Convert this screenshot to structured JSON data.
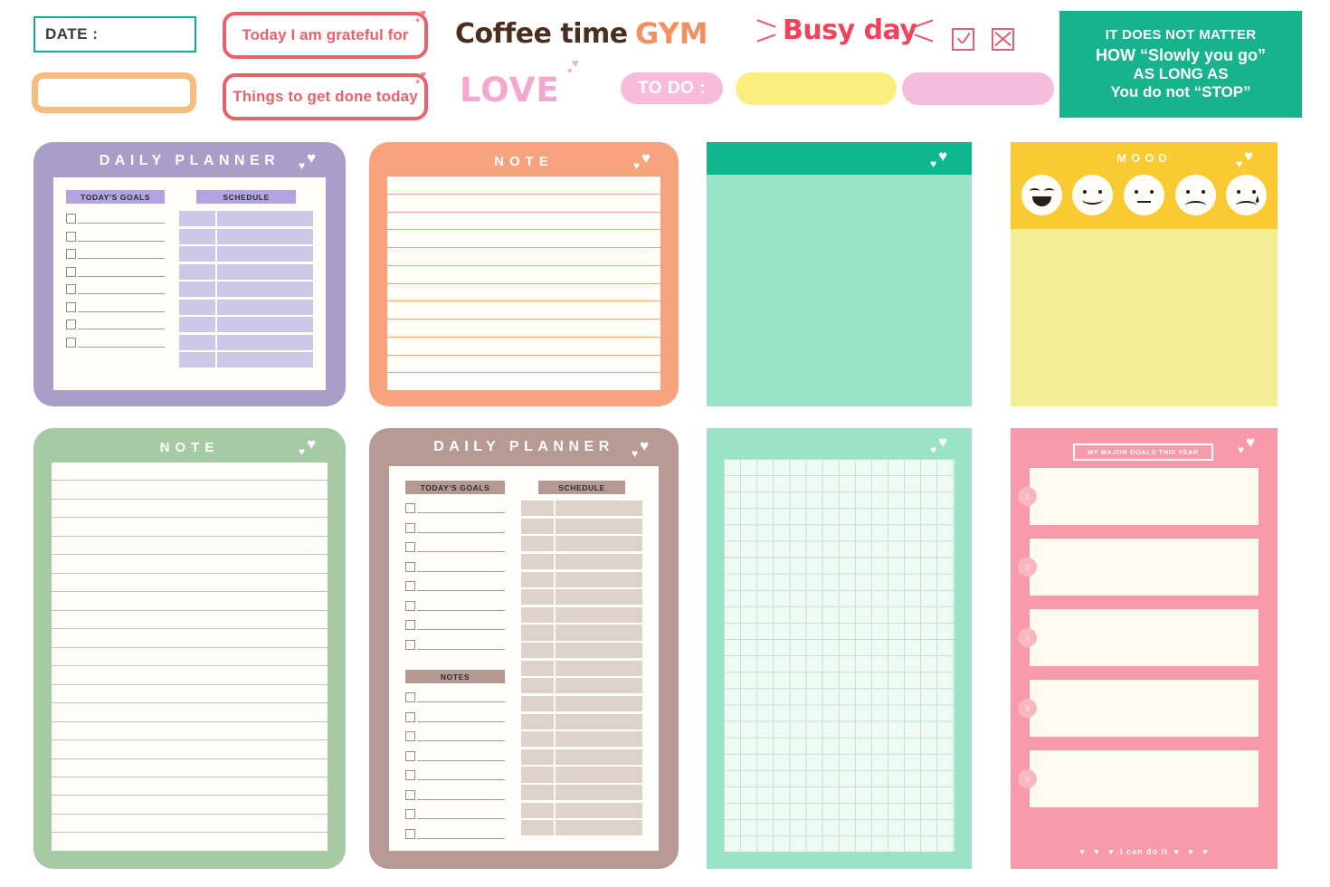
{
  "top_strip": {
    "date_label": "DATE :",
    "orange_blank_pill": "",
    "grateful_label": "Today I am grateful for",
    "things_label": "Things to get done today",
    "coffee_time": "Coffee time",
    "love": "LOVE",
    "gym": "GYM",
    "todo": "TO DO :",
    "busy_day": "Busy day",
    "check_mark_icon": "checkbox-checked",
    "x_mark_icon": "checkbox-crossed",
    "yellow_blank_bar": "",
    "pink_blank_bar": "",
    "quote": {
      "line1": "IT DOES NOT MATTER",
      "line2": "HOW “Slowly you go”",
      "line3": "AS LONG AS",
      "line4": "You do not “STOP”"
    }
  },
  "cards": {
    "daily_planner_purple": {
      "title": "DAILY PLANNER",
      "goals_label": "TODAY'S GOALS",
      "schedule_label": "SCHEDULE",
      "goal_rows": 8,
      "schedule_rows": 9,
      "accent": "#a89ec8",
      "band": "#b0a5e0",
      "sheet": "#fffef8",
      "row_fill": "#cdc7e8"
    },
    "note_orange": {
      "title": "NOTE",
      "lines": 12,
      "accent": "#f7a47e",
      "rule_color": "#eda882"
    },
    "sticky_teal": {
      "title": "",
      "accent": "#9ae3c6",
      "header": "#0fb78e"
    },
    "mood": {
      "title": "MOOD",
      "accent": "#f9ca32",
      "body": "#f2ec92",
      "faces": [
        "happy-laughing-face",
        "smiling-face",
        "neutral-face",
        "sad-face",
        "crying-face"
      ]
    },
    "note_green": {
      "title": "NOTE",
      "lines": 21,
      "accent": "#a6cba4",
      "rule_color": "#b0cfaf"
    },
    "daily_planner_brown": {
      "title": "DAILY PLANNER",
      "goals_label": "TODAY'S GOALS",
      "notes_label": "NOTES",
      "schedule_label": "SCHEDULE",
      "goal_rows": 8,
      "notes_rows": 8,
      "schedule_rows": 19,
      "accent": "#b79a93",
      "band": "#b49a92",
      "sheet": "#fffefb",
      "row_fill": "#ded3ca"
    },
    "grid_paper": {
      "accent": "#9ae3c6",
      "sheet": "#eefbf5",
      "grid_color": "#c2dfd6"
    },
    "major_goals": {
      "title": "MY MAJOR GOALS THIS YEAR",
      "numbers": [
        "1",
        "2",
        "3",
        "4",
        "5"
      ],
      "footer_text": "I can do it",
      "footer_heart": "♥",
      "accent": "#f89aa9",
      "box": "#fefcee"
    }
  },
  "colors": {
    "teal_accent": "#16b38d",
    "red_accent": "#e9626a",
    "pink_accent": "#f6bcd9",
    "orange_accent": "#f29062",
    "yellow_accent": "#faee7e",
    "busy_red": "#f2425c",
    "coffee_brown": "#4a2e1f"
  }
}
